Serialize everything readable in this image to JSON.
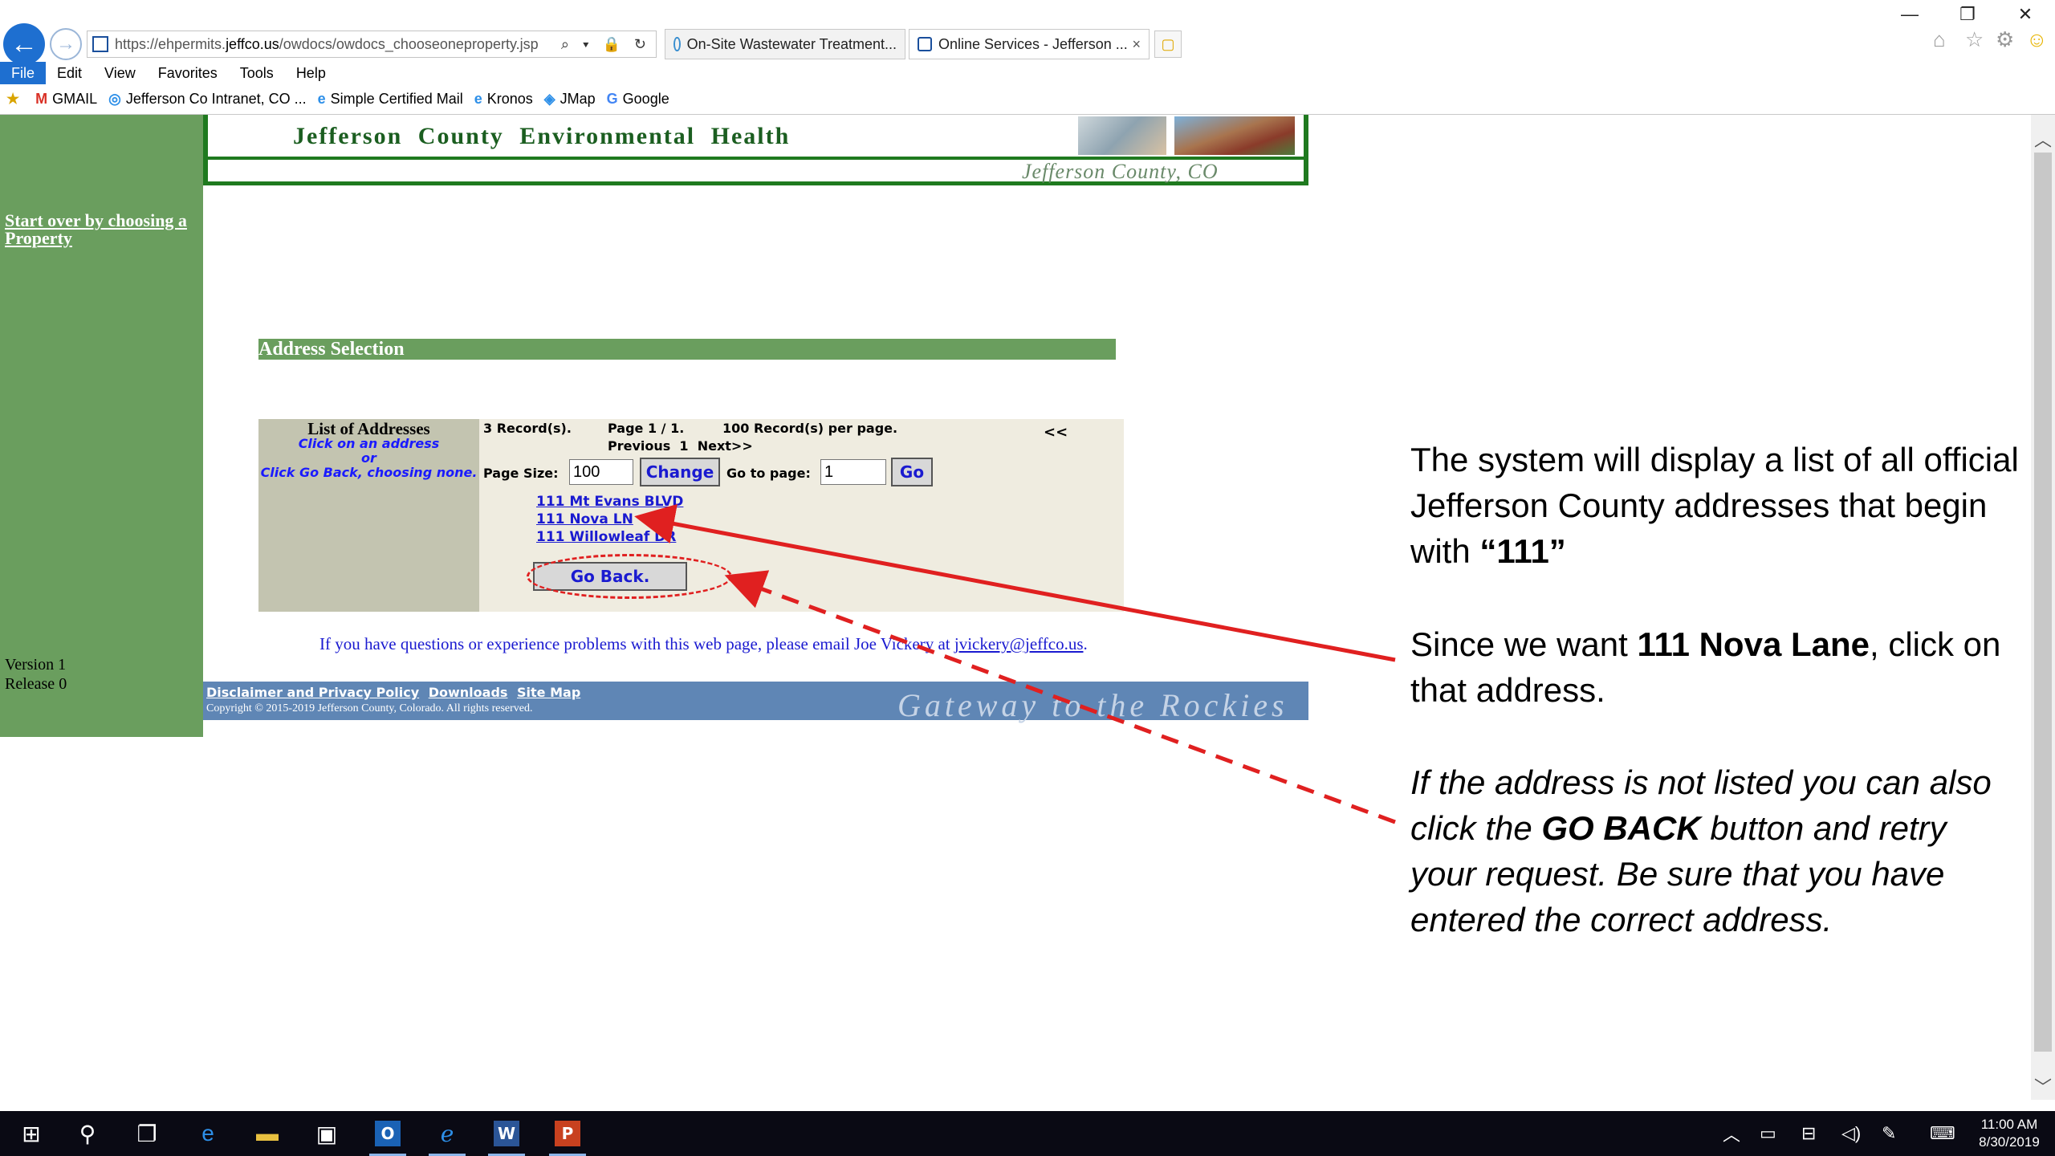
{
  "browser": {
    "url_prefix": "https://ehpermits.",
    "url_domain": "jeffco.us",
    "url_path": "/owdocs/owdocs_chooseoneproperty.jsp",
    "url_tools": "⌕ ▾ 🔒 ↻",
    "tabs": [
      {
        "label": "On-Site Wastewater Treatment..."
      },
      {
        "label": "Online Services - Jefferson ...",
        "close": "×"
      }
    ],
    "menu": [
      "File",
      "Edit",
      "View",
      "Favorites",
      "Tools",
      "Help"
    ],
    "favorites": [
      "GMAIL",
      "Jefferson Co Intranet, CO ...",
      "Simple Certified Mail",
      "Kronos",
      "JMap",
      "Google"
    ],
    "window_controls": {
      "min": "—",
      "max": "❐",
      "close": "✕"
    },
    "icons": [
      "back-arrow-icon",
      "forward-arrow-icon",
      "home-icon",
      "star-icon",
      "gear-icon",
      "smiley-icon"
    ]
  },
  "banner": {
    "title": "Jefferson County Environmental Health",
    "subtitle": "Jefferson County, CO"
  },
  "sidebar": {
    "start_over": "Start over by choosing a Property",
    "version": "Version 1",
    "release": "Release 0"
  },
  "address_selection": {
    "header": "Address Selection",
    "list_title": "List of Addresses",
    "help_line1": "Click on an address",
    "help_line2": "or",
    "help_line3": "Click Go Back, choosing none.",
    "records": "3 Record(s).",
    "page_info": "Page 1 / 1.",
    "per_page": "100 Record(s) per page.",
    "prev_next": "Previous  1  Next>>",
    "nav_back": "<<",
    "page_size_label": "Page Size:",
    "page_size_value": "100",
    "change_label": "Change",
    "goto_label": "Go to page:",
    "goto_value": "1",
    "go_label": "Go",
    "addresses": [
      "111 Mt Evans BLVD",
      "111 Nova LN",
      "111 Willowleaf DR"
    ],
    "go_back_label": "Go Back."
  },
  "contact": {
    "text": "If you have questions or experience problems with this web page, please email Joe Vickery at ",
    "email": "jvickery@jeffco.us",
    "end": "."
  },
  "footer": {
    "links": [
      "Disclaimer and Privacy Policy",
      "Downloads",
      "Site Map"
    ],
    "copyright": "Copyright © 2015-2019  Jefferson County, Colorado. All rights reserved.",
    "slogan": "Gateway to the Rockies"
  },
  "annotations": {
    "note1_a": "The system will display a list of all official Jefferson County addresses that begin with ",
    "note1_b": "“111”",
    "note2_a": "Since we want ",
    "note2_b": "111 Nova Lane",
    "note2_c": ", click on that address.",
    "note3_a": "If the address is not listed you can also click the ",
    "note3_b": "GO BACK",
    "note3_c": " button and retry your request.  Be sure that you have entered the correct address.",
    "arrow_color": "#e02020"
  },
  "taskbar": {
    "apps": [
      "start-icon",
      "search-icon",
      "task-view-icon",
      "edge-icon",
      "file-explorer-icon",
      "store-icon",
      "outlook-icon",
      "internet-explorer-icon",
      "word-icon",
      "powerpoint-icon"
    ],
    "time": "11:00 AM",
    "date": "8/30/2019"
  }
}
